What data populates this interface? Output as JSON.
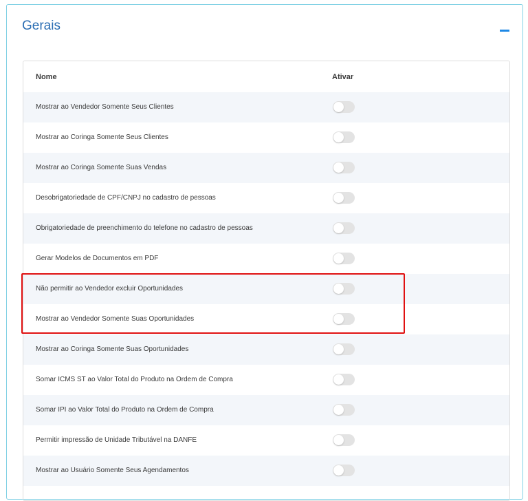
{
  "panel": {
    "title": "Gerais"
  },
  "table": {
    "headers": {
      "name": "Nome",
      "toggle": "Ativar"
    },
    "rows": [
      {
        "label": "Mostrar ao Vendedor Somente Seus Clientes",
        "enabled": false
      },
      {
        "label": "Mostrar ao Coringa Somente Seus Clientes",
        "enabled": false
      },
      {
        "label": "Mostrar ao Coringa Somente Suas Vendas",
        "enabled": false
      },
      {
        "label": "Desobrigatoriedade de CPF/CNPJ no cadastro de pessoas",
        "enabled": false
      },
      {
        "label": "Obrigatoriedade de preenchimento do telefone no cadastro de pessoas",
        "enabled": false
      },
      {
        "label": "Gerar Modelos de Documentos em PDF",
        "enabled": false
      },
      {
        "label": "Não permitir ao Vendedor excluir Oportunidades",
        "enabled": false
      },
      {
        "label": "Mostrar ao Vendedor Somente Suas Oportunidades",
        "enabled": false
      },
      {
        "label": "Mostrar ao Coringa Somente Suas Oportunidades",
        "enabled": false
      },
      {
        "label": "Somar ICMS ST ao Valor Total do Produto na Ordem de Compra",
        "enabled": false
      },
      {
        "label": "Somar IPI ao Valor Total do Produto na Ordem de Compra",
        "enabled": false
      },
      {
        "label": "Permitir impressão de Unidade Tributável na DANFE",
        "enabled": false
      },
      {
        "label": "Mostrar ao Usuário Somente Seus Agendamentos",
        "enabled": false
      }
    ]
  },
  "colors": {
    "title": "#2a6db3",
    "accent": "#1e88e5",
    "highlight": "#e01010",
    "row_stripe": "#f3f6fa",
    "toggle_off": "#e3e3e3"
  }
}
